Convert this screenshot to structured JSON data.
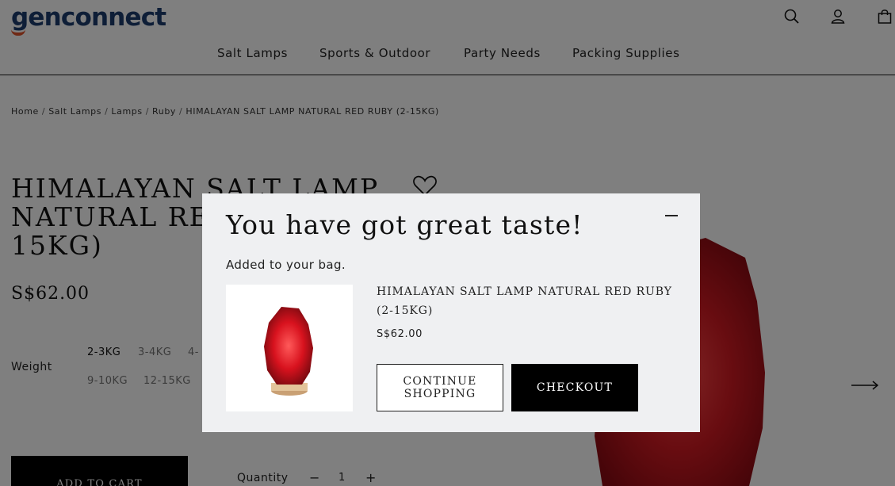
{
  "header": {
    "logo_text": "genconnect",
    "nav": [
      "Salt Lamps",
      "Sports & Outdoor",
      "Party Needs",
      "Packing Supplies"
    ],
    "icons": [
      "search-icon",
      "account-icon",
      "bag-icon"
    ]
  },
  "breadcrumb": [
    "Home",
    "Salt Lamps",
    "Lamps",
    "Ruby",
    "HIMALAYAN SALT LAMP NATURAL RED RUBY (2-15KG)"
  ],
  "product": {
    "title": "HIMALAYAN SALT LAMP NATURAL RED RUBY (2-15KG)",
    "price": "S$62.00",
    "weight_label": "Weight",
    "weights_row1": [
      "2-3KG",
      "3-4KG",
      "4-"
    ],
    "weights_row2": [
      "9-10KG",
      "12-15KG"
    ],
    "add_to_cart": "ADD TO CART",
    "quantity_label": "Quantity",
    "qty_minus": "−",
    "qty_value": "1",
    "qty_plus": "+"
  },
  "modal": {
    "title": "You have got great taste!",
    "subtitle": "Added to your bag.",
    "item_name": "HIMALAYAN SALT LAMP NATURAL RED RUBY (2-15KG)",
    "item_price": "S$62.00",
    "continue_label": "CONTINUE SHOPPING",
    "checkout_label": "CHECKOUT"
  },
  "colors": {
    "logo_blue": "#1d3c6e",
    "logo_orange": "#e0532b",
    "lamp_red": "#c8102e",
    "button_black": "#000000"
  }
}
